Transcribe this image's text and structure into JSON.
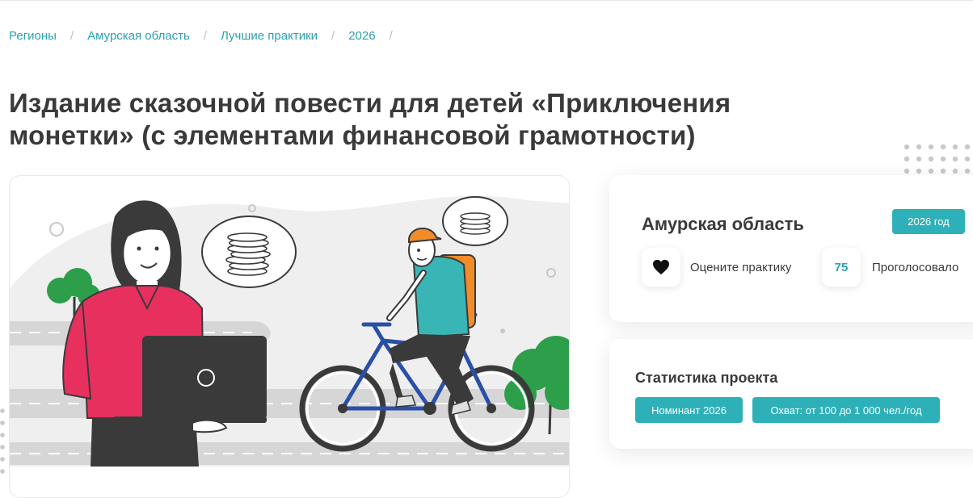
{
  "breadcrumb": {
    "items": [
      "Регионы",
      "Амурская область",
      "Лучшие практики",
      "2026"
    ],
    "separator": "/"
  },
  "page": {
    "title_line1": "Издание сказочной повести для детей «Приключения",
    "title_line2": "монетки» (с элементами финансовой грамотности)"
  },
  "region_card": {
    "region": "Амурская область",
    "year_badge": "2026 год",
    "rate_label": "Оцените практику",
    "votes_count": "75",
    "votes_label": "Проголосовало"
  },
  "stats_card": {
    "title": "Статистика проекта",
    "tags": [
      "Номинант 2026",
      "Охват: от 100 до 1 000 чел./год"
    ]
  },
  "colors": {
    "accent": "#2eb0b8",
    "link": "#2aa1b1",
    "shirt": "#e8305e",
    "tree": "#2d9e4a",
    "bike": "#2a4fa8",
    "cyclist_shirt": "#3ab5b5",
    "backpack": "#f08c2a"
  },
  "icons": {
    "heart": "heart-icon"
  }
}
